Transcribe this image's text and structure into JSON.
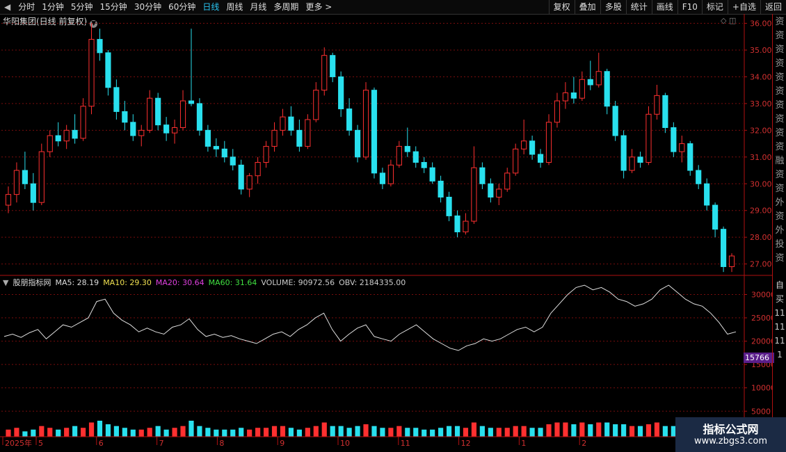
{
  "toolbar": {
    "left_items": [
      "分时",
      "1分钟",
      "5分钟",
      "15分钟",
      "30分钟",
      "60分钟",
      "日线",
      "周线",
      "月线",
      "多周期",
      "更多 >"
    ],
    "active_item": "日线",
    "right_items": [
      "复权",
      "叠加",
      "多股",
      "统计",
      "画线",
      "F10",
      "标记",
      "+自选",
      "返回"
    ]
  },
  "stock_title": "华阳集团(日线 前复权)",
  "main_axis_labels": [
    "36.00",
    "35.00",
    "34.00",
    "33.00",
    "32.00",
    "31.00",
    "30.00",
    "29.00",
    "28.00",
    "27.00"
  ],
  "indicator": {
    "name": "股朋指标网",
    "ma5": "MA5: 28.19",
    "ma10": "MA10: 29.30",
    "ma20": "MA20: 30.64",
    "ma60": "MA60: 31.64",
    "volume": "VOLUME: 90972.56",
    "obv": "OBV: 2184335.00",
    "axis_labels": [
      "30000",
      "25000",
      "20000",
      "15000",
      "10000",
      "5000"
    ],
    "current_value": "15766"
  },
  "date_labels": [
    "2025年",
    "5",
    "6",
    "7",
    "8",
    "9",
    "10",
    "11",
    "12",
    "1",
    "2"
  ],
  "side_chars_top": "资资资资资资资资资资融资资外资外投资投收",
  "side_chars_bottom": "自买1111111",
  "watermark": {
    "line1": "指标公式网",
    "line2": "www.zbgs3.com"
  },
  "colors": {
    "up": "#ff3030",
    "down": "#29e0ee",
    "grid": "#7a0d0d",
    "axis_text": "#d23030",
    "obv_line": "#e0e0e0"
  },
  "chart_data": {
    "type": "candlestick",
    "title": "华阳集团(日线 前复权)",
    "ylim": [
      26.6,
      36.3
    ],
    "candles": [
      {
        "date": "2025-04",
        "open": 29.2,
        "high": 29.9,
        "low": 28.9,
        "close": 29.6
      },
      {
        "date": "",
        "open": 29.6,
        "high": 30.8,
        "low": 29.3,
        "close": 30.5
      },
      {
        "date": "",
        "open": 30.5,
        "high": 31.2,
        "low": 29.8,
        "close": 30.0
      },
      {
        "date": "",
        "open": 30.0,
        "high": 30.4,
        "low": 29.0,
        "close": 29.3
      },
      {
        "date": "",
        "open": 29.3,
        "high": 31.5,
        "low": 29.2,
        "close": 31.2
      },
      {
        "date": "",
        "open": 31.2,
        "high": 32.0,
        "low": 31.0,
        "close": 31.8
      },
      {
        "date": "",
        "open": 31.8,
        "high": 32.3,
        "low": 31.4,
        "close": 31.6
      },
      {
        "date": "",
        "open": 31.6,
        "high": 32.2,
        "low": 31.3,
        "close": 32.0
      },
      {
        "date": "",
        "open": 32.0,
        "high": 32.6,
        "low": 31.5,
        "close": 31.7
      },
      {
        "date": "",
        "open": 31.7,
        "high": 33.2,
        "low": 31.6,
        "close": 32.9
      },
      {
        "date": "",
        "open": 32.9,
        "high": 36.0,
        "low": 32.6,
        "close": 35.4
      },
      {
        "date": "",
        "open": 35.4,
        "high": 35.8,
        "low": 34.6,
        "close": 34.9
      },
      {
        "date": "",
        "open": 34.9,
        "high": 35.0,
        "low": 33.3,
        "close": 33.6
      },
      {
        "date": "",
        "open": 33.6,
        "high": 33.9,
        "low": 32.4,
        "close": 32.7
      },
      {
        "date": "",
        "open": 32.7,
        "high": 33.1,
        "low": 32.0,
        "close": 32.3
      },
      {
        "date": "",
        "open": 32.3,
        "high": 32.6,
        "low": 31.6,
        "close": 31.8
      },
      {
        "date": "",
        "open": 31.8,
        "high": 32.2,
        "low": 31.4,
        "close": 32.0
      },
      {
        "date": "",
        "open": 32.0,
        "high": 33.5,
        "low": 31.9,
        "close": 33.2
      },
      {
        "date": "",
        "open": 33.2,
        "high": 33.4,
        "low": 32.0,
        "close": 32.2
      },
      {
        "date": "",
        "open": 32.2,
        "high": 32.5,
        "low": 31.6,
        "close": 31.9
      },
      {
        "date": "",
        "open": 31.9,
        "high": 32.4,
        "low": 31.5,
        "close": 32.1
      },
      {
        "date": "",
        "open": 32.1,
        "high": 33.5,
        "low": 32.0,
        "close": 33.1
      },
      {
        "date": "",
        "open": 33.1,
        "high": 35.8,
        "low": 32.9,
        "close": 33.0
      },
      {
        "date": "",
        "open": 33.0,
        "high": 33.2,
        "low": 31.8,
        "close": 32.0
      },
      {
        "date": "",
        "open": 32.0,
        "high": 32.2,
        "low": 31.2,
        "close": 31.4
      },
      {
        "date": "",
        "open": 31.4,
        "high": 31.7,
        "low": 31.0,
        "close": 31.3
      },
      {
        "date": "",
        "open": 31.3,
        "high": 31.6,
        "low": 30.8,
        "close": 31.0
      },
      {
        "date": "",
        "open": 31.0,
        "high": 31.3,
        "low": 30.5,
        "close": 30.7
      },
      {
        "date": "",
        "open": 30.7,
        "high": 30.9,
        "low": 29.6,
        "close": 29.8
      },
      {
        "date": "",
        "open": 29.8,
        "high": 30.4,
        "low": 29.5,
        "close": 30.3
      },
      {
        "date": "",
        "open": 30.3,
        "high": 31.0,
        "low": 30.0,
        "close": 30.8
      },
      {
        "date": "",
        "open": 30.8,
        "high": 31.6,
        "low": 30.6,
        "close": 31.4
      },
      {
        "date": "",
        "open": 31.4,
        "high": 32.3,
        "low": 31.2,
        "close": 32.0
      },
      {
        "date": "",
        "open": 32.0,
        "high": 32.8,
        "low": 31.8,
        "close": 32.5
      },
      {
        "date": "",
        "open": 32.5,
        "high": 32.9,
        "low": 31.8,
        "close": 32.0
      },
      {
        "date": "",
        "open": 32.0,
        "high": 32.4,
        "low": 31.2,
        "close": 31.4
      },
      {
        "date": "",
        "open": 31.4,
        "high": 32.6,
        "low": 31.3,
        "close": 32.4
      },
      {
        "date": "",
        "open": 32.4,
        "high": 33.8,
        "low": 32.3,
        "close": 33.5
      },
      {
        "date": "",
        "open": 33.5,
        "high": 35.1,
        "low": 33.3,
        "close": 34.8
      },
      {
        "date": "",
        "open": 34.8,
        "high": 34.9,
        "low": 33.8,
        "close": 34.0
      },
      {
        "date": "",
        "open": 34.0,
        "high": 34.2,
        "low": 32.5,
        "close": 32.8
      },
      {
        "date": "",
        "open": 32.8,
        "high": 33.2,
        "low": 31.8,
        "close": 32.0
      },
      {
        "date": "",
        "open": 32.0,
        "high": 32.2,
        "low": 30.8,
        "close": 31.0
      },
      {
        "date": "",
        "open": 31.0,
        "high": 33.8,
        "low": 30.9,
        "close": 33.5
      },
      {
        "date": "",
        "open": 33.5,
        "high": 33.6,
        "low": 30.2,
        "close": 30.4
      },
      {
        "date": "",
        "open": 30.4,
        "high": 30.6,
        "low": 29.8,
        "close": 30.0
      },
      {
        "date": "",
        "open": 30.0,
        "high": 30.9,
        "low": 29.9,
        "close": 30.7
      },
      {
        "date": "",
        "open": 30.7,
        "high": 31.6,
        "low": 30.6,
        "close": 31.4
      },
      {
        "date": "",
        "open": 31.4,
        "high": 32.1,
        "low": 31.0,
        "close": 31.2
      },
      {
        "date": "",
        "open": 31.2,
        "high": 31.4,
        "low": 30.6,
        "close": 30.8
      },
      {
        "date": "",
        "open": 30.8,
        "high": 31.0,
        "low": 30.4,
        "close": 30.6
      },
      {
        "date": "",
        "open": 30.6,
        "high": 30.8,
        "low": 30.0,
        "close": 30.1
      },
      {
        "date": "",
        "open": 30.1,
        "high": 30.3,
        "low": 29.3,
        "close": 29.5
      },
      {
        "date": "",
        "open": 29.5,
        "high": 29.7,
        "low": 28.6,
        "close": 28.8
      },
      {
        "date": "",
        "open": 28.8,
        "high": 29.0,
        "low": 28.0,
        "close": 28.2
      },
      {
        "date": "",
        "open": 28.2,
        "high": 28.9,
        "low": 28.1,
        "close": 28.6
      },
      {
        "date": "",
        "open": 28.6,
        "high": 31.4,
        "low": 28.5,
        "close": 30.6
      },
      {
        "date": "",
        "open": 30.6,
        "high": 30.8,
        "low": 29.8,
        "close": 30.0
      },
      {
        "date": "",
        "open": 30.0,
        "high": 30.2,
        "low": 29.3,
        "close": 29.5
      },
      {
        "date": "",
        "open": 29.5,
        "high": 30.0,
        "low": 29.2,
        "close": 29.8
      },
      {
        "date": "",
        "open": 29.8,
        "high": 30.6,
        "low": 29.7,
        "close": 30.4
      },
      {
        "date": "",
        "open": 30.4,
        "high": 31.5,
        "low": 30.3,
        "close": 31.3
      },
      {
        "date": "",
        "open": 31.3,
        "high": 32.4,
        "low": 31.1,
        "close": 31.6
      },
      {
        "date": "",
        "open": 31.6,
        "high": 31.8,
        "low": 30.9,
        "close": 31.1
      },
      {
        "date": "",
        "open": 31.1,
        "high": 31.3,
        "low": 30.6,
        "close": 30.8
      },
      {
        "date": "",
        "open": 30.8,
        "high": 32.6,
        "low": 30.7,
        "close": 32.3
      },
      {
        "date": "",
        "open": 32.3,
        "high": 33.4,
        "low": 32.1,
        "close": 33.1
      },
      {
        "date": "",
        "open": 33.1,
        "high": 33.8,
        "low": 32.8,
        "close": 33.4
      },
      {
        "date": "",
        "open": 33.4,
        "high": 34.0,
        "low": 33.0,
        "close": 33.2
      },
      {
        "date": "",
        "open": 33.2,
        "high": 34.2,
        "low": 33.1,
        "close": 33.9
      },
      {
        "date": "",
        "open": 33.9,
        "high": 34.6,
        "low": 33.5,
        "close": 33.7
      },
      {
        "date": "",
        "open": 33.7,
        "high": 34.9,
        "low": 33.6,
        "close": 34.2
      },
      {
        "date": "",
        "open": 34.2,
        "high": 34.3,
        "low": 32.6,
        "close": 32.9
      },
      {
        "date": "",
        "open": 32.9,
        "high": 33.1,
        "low": 31.6,
        "close": 31.8
      },
      {
        "date": "",
        "open": 31.8,
        "high": 32.0,
        "low": 30.2,
        "close": 30.5
      },
      {
        "date": "",
        "open": 30.5,
        "high": 31.3,
        "low": 30.4,
        "close": 31.0
      },
      {
        "date": "",
        "open": 31.0,
        "high": 31.2,
        "low": 30.6,
        "close": 30.8
      },
      {
        "date": "",
        "open": 30.8,
        "high": 32.9,
        "low": 30.7,
        "close": 32.6
      },
      {
        "date": "",
        "open": 32.6,
        "high": 33.7,
        "low": 32.4,
        "close": 33.3
      },
      {
        "date": "",
        "open": 33.3,
        "high": 33.4,
        "low": 31.9,
        "close": 32.1
      },
      {
        "date": "",
        "open": 32.1,
        "high": 32.3,
        "low": 31.0,
        "close": 31.2
      },
      {
        "date": "",
        "open": 31.2,
        "high": 31.8,
        "low": 30.8,
        "close": 31.5
      },
      {
        "date": "",
        "open": 31.5,
        "high": 31.6,
        "low": 30.3,
        "close": 30.5
      },
      {
        "date": "",
        "open": 30.5,
        "high": 30.7,
        "low": 29.8,
        "close": 30.0
      },
      {
        "date": "",
        "open": 30.0,
        "high": 30.2,
        "low": 29.0,
        "close": 29.2
      },
      {
        "date": "",
        "open": 29.2,
        "high": 29.3,
        "low": 28.0,
        "close": 28.3
      },
      {
        "date": "",
        "open": 28.3,
        "high": 28.4,
        "low": 26.7,
        "close": 26.9
      },
      {
        "date": "",
        "open": 26.9,
        "high": 27.4,
        "low": 26.7,
        "close": 27.3
      }
    ]
  },
  "obv_data": {
    "type": "line",
    "ylim": [
      4000,
      33500
    ],
    "values": [
      21000,
      21500,
      20800,
      21800,
      22500,
      20500,
      22000,
      23500,
      23000,
      24000,
      25000,
      28500,
      29000,
      26000,
      24500,
      23500,
      22000,
      22800,
      22000,
      21500,
      23000,
      23500,
      24800,
      22500,
      21000,
      21500,
      20800,
      21200,
      20500,
      20000,
      19500,
      20500,
      21500,
      22000,
      21000,
      22500,
      23500,
      25000,
      26000,
      22500,
      20000,
      21500,
      22800,
      23500,
      21000,
      20500,
      20000,
      21500,
      22500,
      23500,
      22000,
      20500,
      19500,
      18500,
      18000,
      19000,
      19500,
      20500,
      20000,
      20500,
      21500,
      22500,
      23000,
      22000,
      23000,
      26000,
      28000,
      30000,
      31500,
      32000,
      31000,
      31500,
      30500,
      29000,
      28500,
      27500,
      28000,
      29000,
      31000,
      32000,
      30500,
      29000,
      28000,
      27500,
      26000,
      24000,
      21500,
      22000
    ]
  },
  "volume_data": {
    "type": "bar",
    "values": [
      4,
      5,
      3,
      4,
      6,
      5,
      4,
      5,
      6,
      5,
      8,
      9,
      7,
      6,
      5,
      4,
      4,
      5,
      6,
      4,
      5,
      6,
      9,
      6,
      5,
      4,
      4,
      4,
      5,
      4,
      5,
      5,
      6,
      6,
      5,
      4,
      5,
      6,
      8,
      6,
      6,
      5,
      6,
      7,
      6,
      5,
      5,
      6,
      5,
      5,
      4,
      4,
      5,
      6,
      6,
      5,
      8,
      6,
      5,
      5,
      5,
      6,
      6,
      5,
      5,
      7,
      8,
      8,
      7,
      8,
      7,
      8,
      8,
      7,
      7,
      6,
      6,
      7,
      8,
      6,
      6,
      6,
      6,
      7,
      7,
      8,
      9,
      7
    ]
  }
}
